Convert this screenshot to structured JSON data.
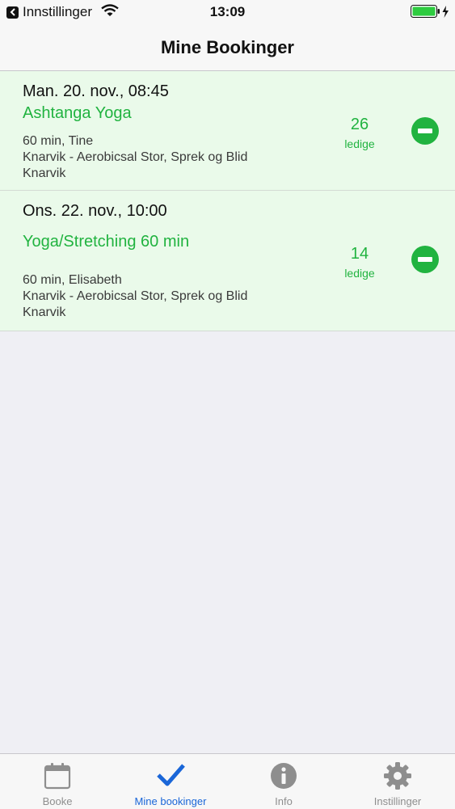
{
  "status_bar": {
    "back_app": "Innstillinger",
    "time": "13:09"
  },
  "nav": {
    "title": "Mine Bookinger"
  },
  "bookings": [
    {
      "date": "Man. 20. nov., 08:45",
      "title": "Ashtanga Yoga",
      "duration_instructor": "60 min, Tine",
      "location": "Knarvik - Aerobicsal Stor, Sprek og Blid Knarvik",
      "spots_count": "26",
      "spots_label": "ledige"
    },
    {
      "date": "Ons. 22. nov., 10:00",
      "title": "Yoga/Stretching 60 min",
      "duration_instructor": "60 min, Elisabeth",
      "location": "Knarvik - Aerobicsal Stor, Sprek og Blid Knarvik",
      "spots_count": "14",
      "spots_label": "ledige"
    }
  ],
  "tabs": [
    {
      "label": "Booke",
      "icon": "calendar-icon",
      "active": false
    },
    {
      "label": "Mine bookinger",
      "icon": "checkmark-icon",
      "active": true
    },
    {
      "label": "Info",
      "icon": "info-icon",
      "active": false
    },
    {
      "label": "Instillinger",
      "icon": "gear-icon",
      "active": false
    }
  ],
  "colors": {
    "accent_green": "#21b340",
    "active_tab_blue": "#1a66d8",
    "row_background": "#eafaea"
  }
}
